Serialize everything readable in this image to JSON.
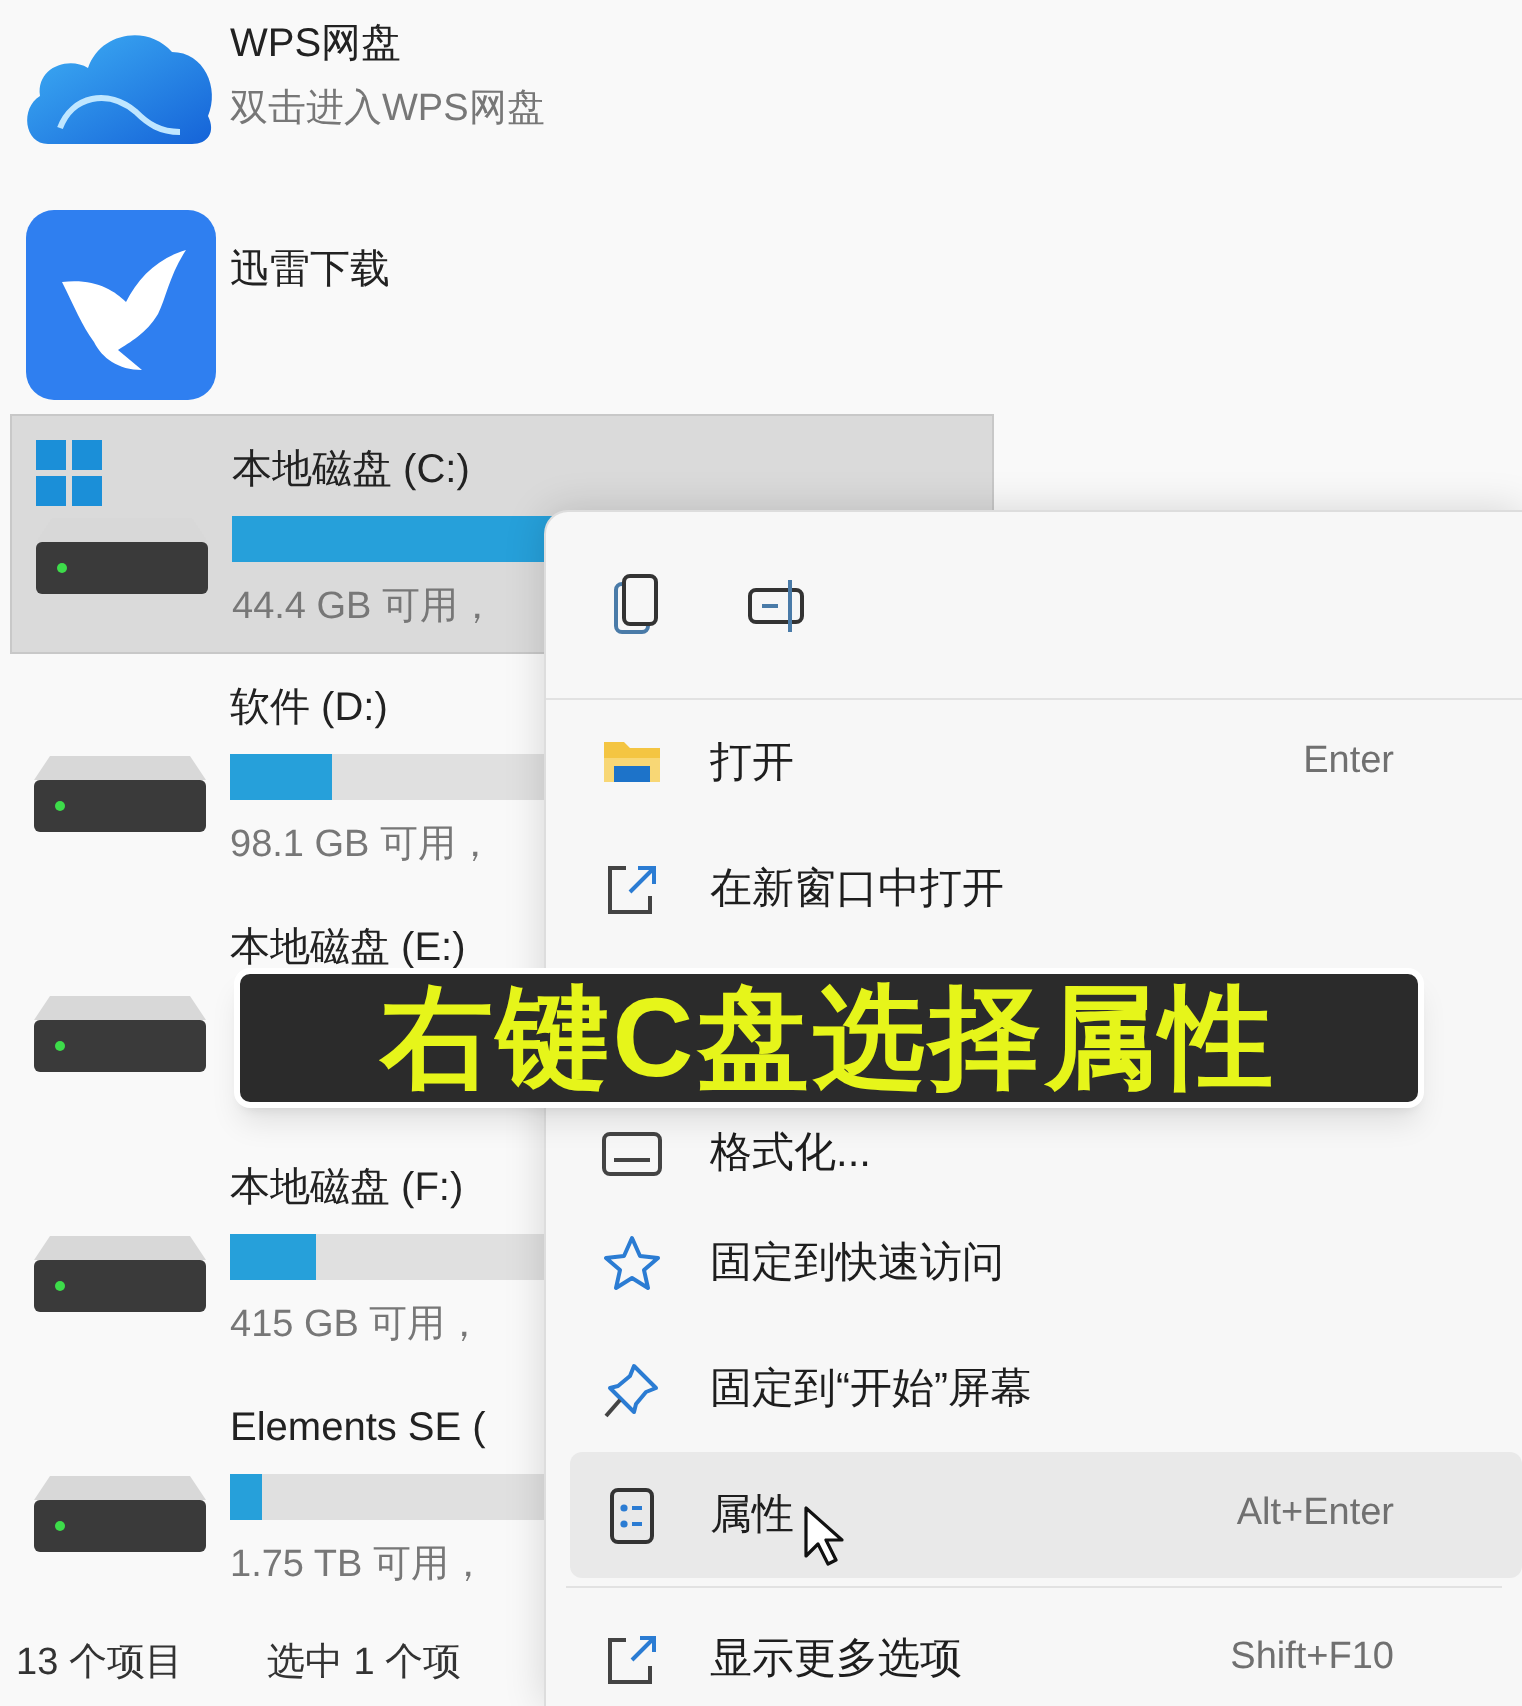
{
  "apps": [
    {
      "kind": "cloud",
      "name": "WPS网盘",
      "subtitle": "双击进入WPS网盘"
    },
    {
      "kind": "bird",
      "name": "迅雷下载"
    }
  ],
  "drives": [
    {
      "kind": "system",
      "name": "本地磁盘 (C:)",
      "level": 1.0,
      "usage": "44.4 GB 可用，",
      "selected": true
    },
    {
      "kind": "disk",
      "name": "软件 (D:)",
      "level": 0.32,
      "usage": "98.1 GB 可用，",
      "selected": false
    },
    {
      "kind": "disk",
      "name": "本地磁盘 (E:)",
      "selected": false
    },
    {
      "kind": "disk",
      "name": "本地磁盘 (F:)",
      "level": 0.27,
      "usage": "415 GB 可用，",
      "selected": false
    },
    {
      "kind": "disk",
      "name": "Elements SE (",
      "level": 0.1,
      "usage": "1.75 TB 可用，",
      "selected": false
    }
  ],
  "status_bar": {
    "count": "13 个项目",
    "selection": "选中 1 个项"
  },
  "context_menu": {
    "toolbar": [
      {
        "kind": "copy"
      },
      {
        "kind": "rename"
      }
    ],
    "groups": [
      [
        {
          "kind": "open",
          "label": "打开",
          "shortcut": "Enter",
          "highlighted": false
        },
        {
          "kind": "new-window",
          "label": "在新窗口中打开",
          "highlighted": false
        }
      ],
      [
        {
          "kind": "format",
          "label": "格式化...",
          "highlighted": false
        },
        {
          "kind": "star",
          "label": "固定到快速访问",
          "highlighted": false
        },
        {
          "kind": "pin",
          "label": "固定到“开始”屏幕",
          "highlighted": false
        },
        {
          "kind": "properties",
          "label": "属性",
          "shortcut": "Alt+Enter",
          "highlighted": true
        }
      ],
      [
        {
          "kind": "more",
          "label": "显示更多选项",
          "shortcut": "Shift+F10",
          "highlighted": false
        }
      ]
    ]
  },
  "caption": "右键C盘选择属性"
}
